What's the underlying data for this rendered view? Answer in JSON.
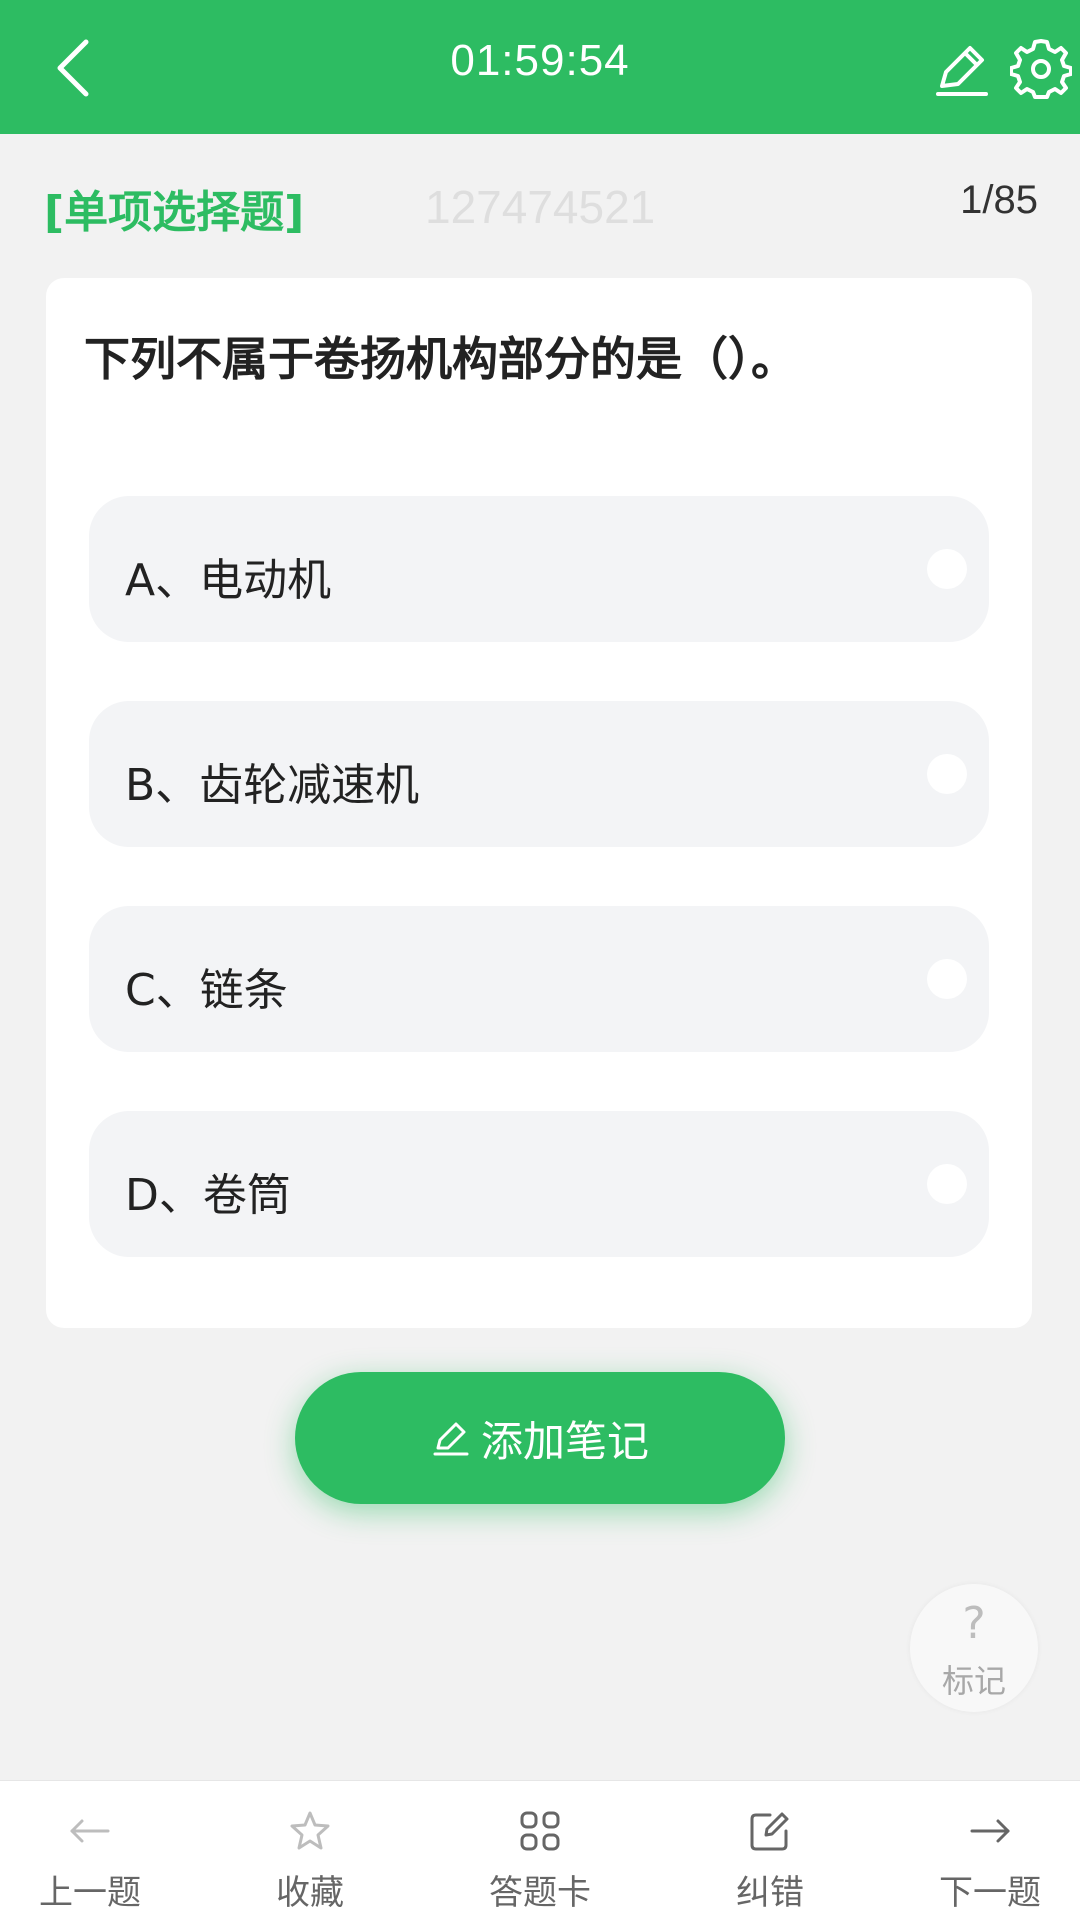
{
  "header": {
    "timer": "01:59:54",
    "accent_color": "#2dbc62",
    "back_icon": "chevron-left-icon",
    "edit_icon": "pen-icon",
    "settings_icon": "gear-icon"
  },
  "question_meta": {
    "type_label": "[单项选择题]",
    "watermark": "127474521",
    "progress": "1/85"
  },
  "question": {
    "text": "下列不属于卷扬机构部分的是（）。",
    "options": [
      {
        "label": "A、电动机"
      },
      {
        "label": "B、齿轮减速机"
      },
      {
        "label": "C、链条"
      },
      {
        "label": "D、卷筒"
      }
    ]
  },
  "note_button": {
    "label": "添加笔记",
    "icon": "pen-icon"
  },
  "mark_button": {
    "symbol": "?",
    "label": "标记"
  },
  "bottom_nav": [
    {
      "label": "上一题",
      "icon": "arrow-left-icon"
    },
    {
      "label": "收藏",
      "icon": "star-icon"
    },
    {
      "label": "答题卡",
      "icon": "grid-icon"
    },
    {
      "label": "纠错",
      "icon": "edit-box-icon"
    },
    {
      "label": "下一题",
      "icon": "arrow-right-icon"
    }
  ]
}
